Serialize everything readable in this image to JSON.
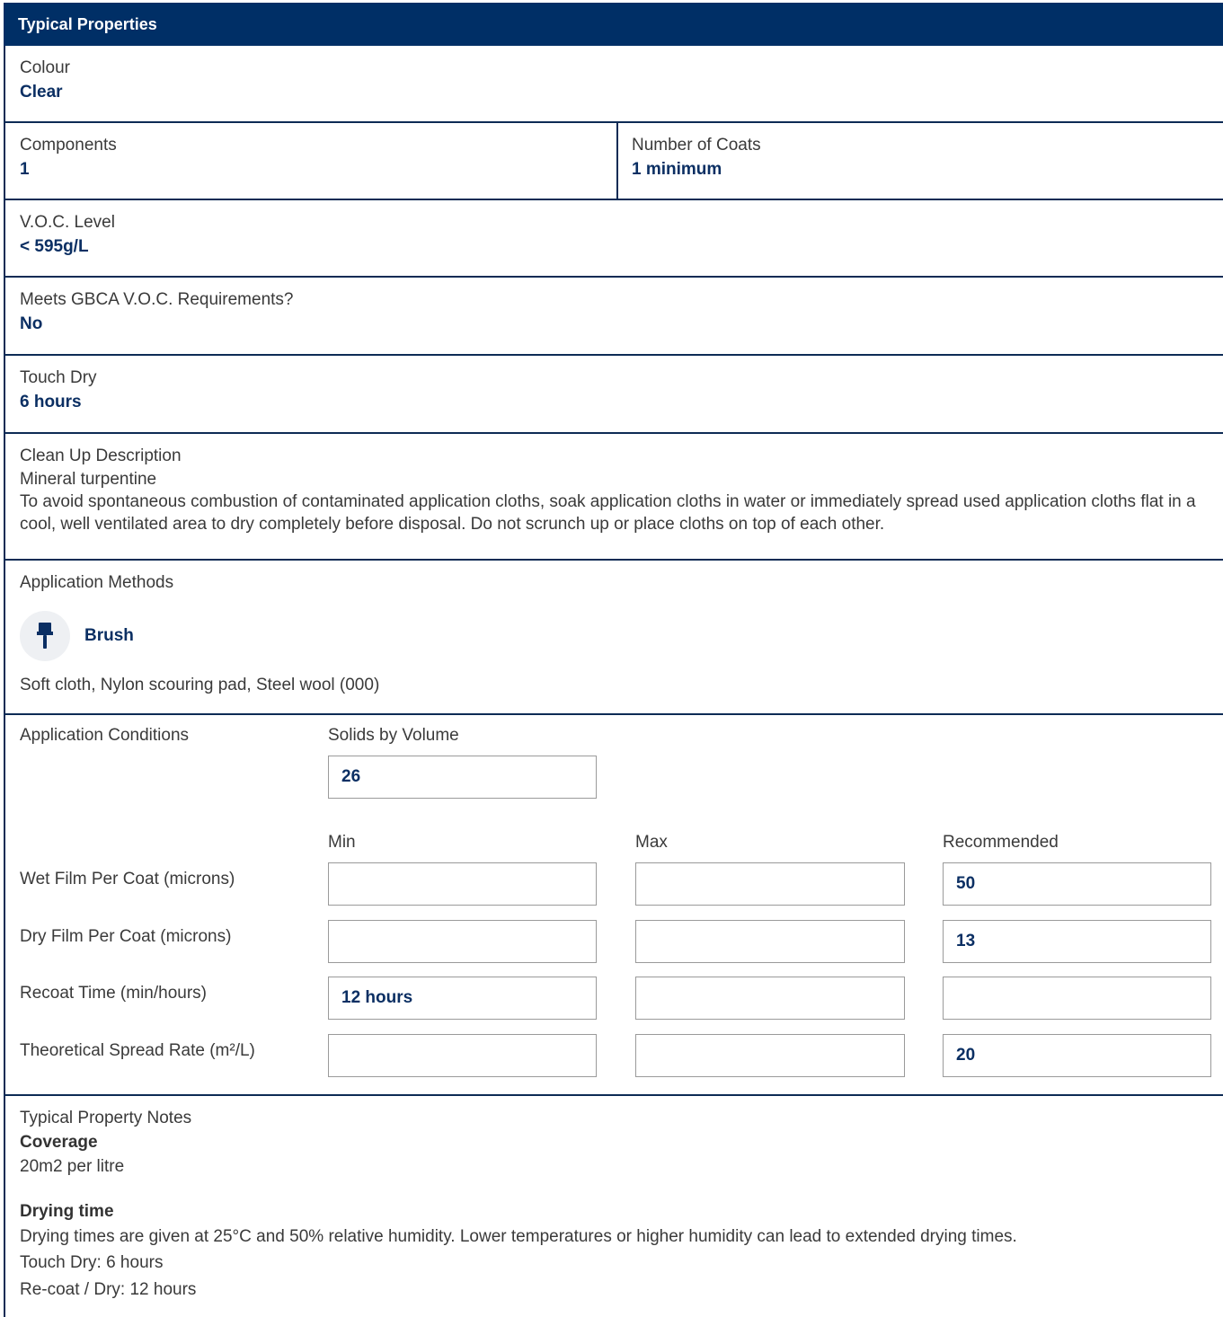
{
  "header": {
    "title": "Typical Properties"
  },
  "colour": {
    "label": "Colour",
    "value": "Clear"
  },
  "components": {
    "label": "Components",
    "value": "1"
  },
  "coats": {
    "label": "Number of Coats",
    "value": "1 minimum"
  },
  "voc": {
    "label": "V.O.C. Level",
    "value": "< 595g/L"
  },
  "gbca": {
    "label": "Meets GBCA V.O.C. Requirements?",
    "value": "No"
  },
  "touch_dry": {
    "label": "Touch Dry",
    "value": "6 hours"
  },
  "cleanup": {
    "label": "Clean Up Description",
    "line1": "Mineral turpentine",
    "line2": "To avoid spontaneous combustion of contaminated application cloths, soak application cloths in water or immediately spread used application cloths flat in a cool, well ventilated area to dry completely before disposal. Do not scrunch up or place cloths on top of each other."
  },
  "methods": {
    "label": "Application Methods",
    "brush_label": "Brush",
    "brush_icon": "paint-brush-icon",
    "other": "Soft cloth, Nylon scouring pad, Steel wool (000)"
  },
  "conditions": {
    "label": "Application Conditions",
    "solids_label": "Solids by Volume",
    "solids_value": "26",
    "columns": [
      "Min",
      "Max",
      "Recommended"
    ],
    "rows": [
      {
        "label": "Wet Film Per Coat (microns)",
        "min": "",
        "max": "",
        "rec": "50"
      },
      {
        "label": "Dry Film Per Coat (microns)",
        "min": "",
        "max": "",
        "rec": "13"
      },
      {
        "label": "Recoat Time (min/hours)",
        "min": "12 hours",
        "max": "",
        "rec": ""
      },
      {
        "label": "Theoretical Spread Rate (m²/L)",
        "min": "",
        "max": "",
        "rec": "20"
      }
    ]
  },
  "notes": {
    "label": "Typical Property Notes",
    "coverage_head": "Coverage",
    "coverage_text": "20m2 per litre",
    "drying_head": "Drying time",
    "drying_text": "Drying times are given at 25°C and 50% relative humidity. Lower temperatures or higher humidity can lead to extended drying times.",
    "touch_dry": "Touch Dry: 6 hours",
    "recoat": "Re-coat / Dry: 12 hours"
  },
  "colors": {
    "header_bg": "#002f66",
    "value_text": "#0b2f63",
    "border": "#0d2b55"
  }
}
